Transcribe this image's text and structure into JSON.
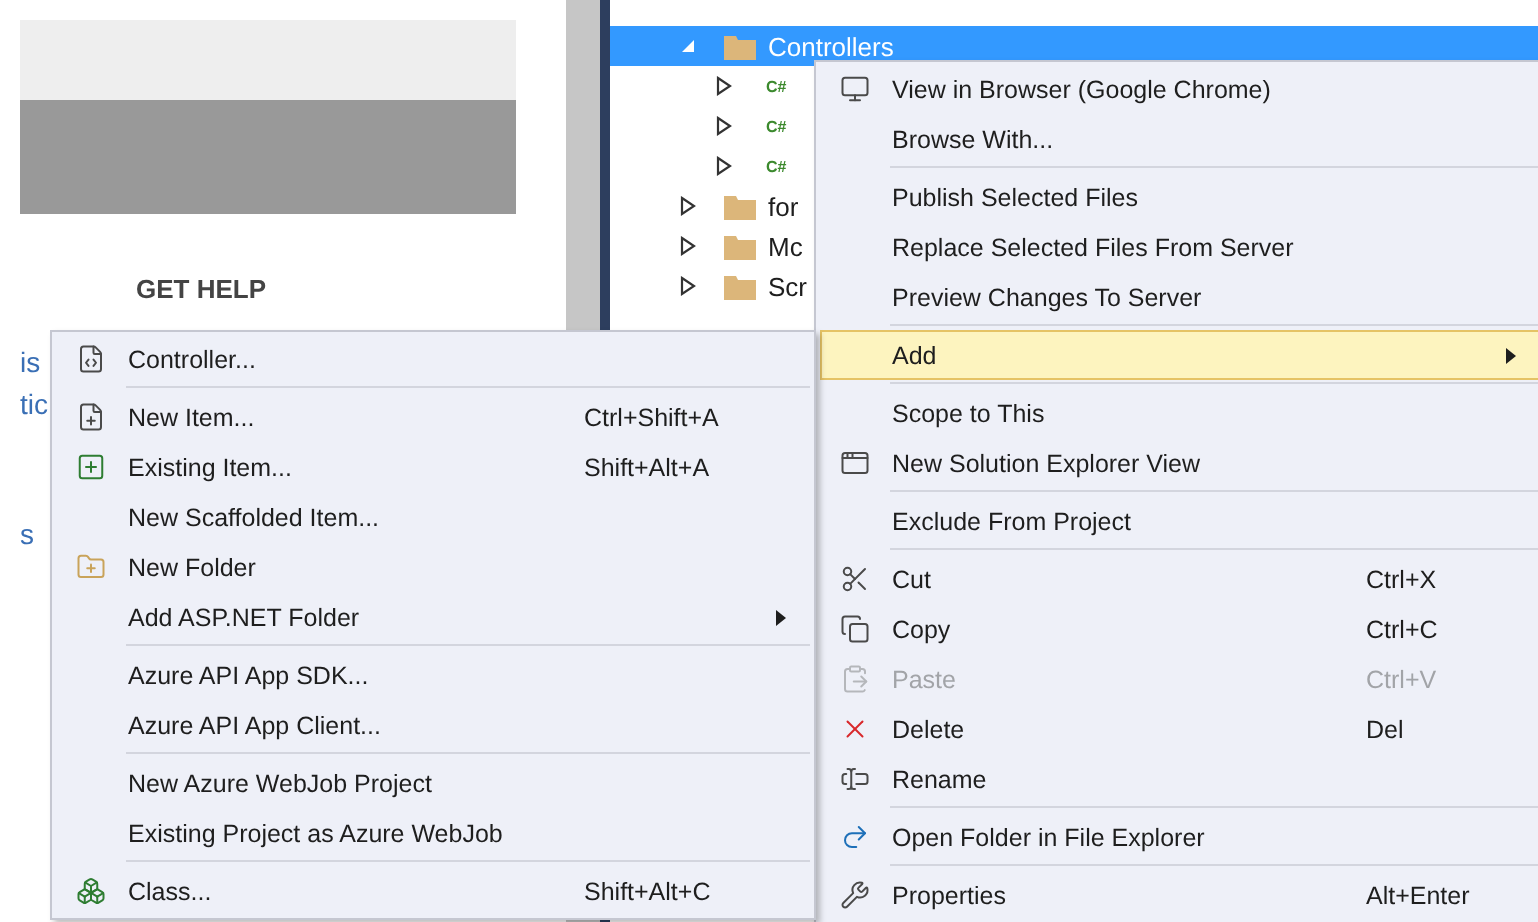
{
  "page": {
    "heading": "GET HELP",
    "links": [
      "is",
      "tic",
      "s"
    ]
  },
  "tree": {
    "items": [
      {
        "kind": "folder",
        "label": "Controllers",
        "expanded": true,
        "selected": true,
        "children": [
          {
            "kind": "csharp",
            "badge": "C#",
            "expanded": false
          },
          {
            "kind": "csharp",
            "badge": "C#",
            "expanded": false
          },
          {
            "kind": "csharp",
            "badge": "C#",
            "expanded": false
          }
        ]
      },
      {
        "kind": "folder",
        "label": "for",
        "expanded": false,
        "selected": false
      },
      {
        "kind": "folder",
        "label": "Mc",
        "expanded": false,
        "selected": false
      },
      {
        "kind": "folder",
        "label": "Scr",
        "expanded": false,
        "selected": false
      }
    ]
  },
  "context_menu": {
    "items": [
      {
        "kind": "item",
        "label": "View in Browser (Google Chrome)",
        "selected": false,
        "disabled": false,
        "submenu": false
      },
      {
        "kind": "item",
        "label": "Browse With...",
        "selected": false,
        "disabled": false,
        "submenu": false
      },
      {
        "kind": "separator"
      },
      {
        "kind": "item",
        "label": "Publish Selected Files",
        "selected": false,
        "disabled": false,
        "submenu": false
      },
      {
        "kind": "item",
        "label": "Replace Selected Files From Server",
        "selected": false,
        "disabled": false,
        "submenu": false
      },
      {
        "kind": "item",
        "label": "Preview Changes To Server",
        "selected": false,
        "disabled": false,
        "submenu": false
      },
      {
        "kind": "separator"
      },
      {
        "kind": "item",
        "label": "Add",
        "selected": true,
        "disabled": false,
        "submenu": true
      },
      {
        "kind": "separator"
      },
      {
        "kind": "item",
        "label": "Scope to This",
        "selected": false,
        "disabled": false,
        "submenu": false
      },
      {
        "kind": "item",
        "label": "New Solution Explorer View",
        "selected": false,
        "disabled": false,
        "submenu": false
      },
      {
        "kind": "separator"
      },
      {
        "kind": "item",
        "label": "Exclude From Project",
        "selected": false,
        "disabled": false,
        "submenu": false
      },
      {
        "kind": "separator"
      },
      {
        "kind": "item",
        "label": "Cut",
        "shortcut": "Ctrl+X",
        "selected": false,
        "disabled": false,
        "submenu": false
      },
      {
        "kind": "item",
        "label": "Copy",
        "shortcut": "Ctrl+C",
        "selected": false,
        "disabled": false,
        "submenu": false
      },
      {
        "kind": "item",
        "label": "Paste",
        "shortcut": "Ctrl+V",
        "selected": false,
        "disabled": true,
        "submenu": false
      },
      {
        "kind": "item",
        "label": "Delete",
        "shortcut": "Del",
        "selected": false,
        "disabled": false,
        "submenu": false
      },
      {
        "kind": "item",
        "label": "Rename",
        "selected": false,
        "disabled": false,
        "submenu": false
      },
      {
        "kind": "separator"
      },
      {
        "kind": "item",
        "label": "Open Folder in File Explorer",
        "selected": false,
        "disabled": false,
        "submenu": false
      },
      {
        "kind": "separator"
      },
      {
        "kind": "item",
        "label": "Properties",
        "shortcut": "Alt+Enter",
        "selected": false,
        "disabled": false,
        "submenu": false
      }
    ]
  },
  "add_submenu": {
    "items": [
      {
        "kind": "item",
        "label": "Controller...",
        "selected": false,
        "disabled": false,
        "submenu": false
      },
      {
        "kind": "separator"
      },
      {
        "kind": "item",
        "label": "New Item...",
        "shortcut": "Ctrl+Shift+A",
        "selected": false,
        "disabled": false,
        "submenu": false
      },
      {
        "kind": "item",
        "label": "Existing Item...",
        "shortcut": "Shift+Alt+A",
        "selected": false,
        "disabled": false,
        "submenu": false
      },
      {
        "kind": "item",
        "label": "New Scaffolded Item...",
        "selected": false,
        "disabled": false,
        "submenu": false
      },
      {
        "kind": "item",
        "label": "New Folder",
        "selected": false,
        "disabled": false,
        "submenu": false
      },
      {
        "kind": "item",
        "label": "Add ASP.NET Folder",
        "selected": false,
        "disabled": false,
        "submenu": true
      },
      {
        "kind": "separator"
      },
      {
        "kind": "item",
        "label": "Azure API App SDK...",
        "selected": false,
        "disabled": false,
        "submenu": false
      },
      {
        "kind": "item",
        "label": "Azure API App Client...",
        "selected": false,
        "disabled": false,
        "submenu": false
      },
      {
        "kind": "separator"
      },
      {
        "kind": "item",
        "label": "New Azure WebJob Project",
        "selected": false,
        "disabled": false,
        "submenu": false
      },
      {
        "kind": "item",
        "label": "Existing Project as Azure WebJob",
        "selected": false,
        "disabled": false,
        "submenu": false
      },
      {
        "kind": "separator"
      },
      {
        "kind": "item",
        "label": "Class...",
        "shortcut": "Shift+Alt+C",
        "selected": false,
        "disabled": false,
        "submenu": false
      }
    ]
  }
}
